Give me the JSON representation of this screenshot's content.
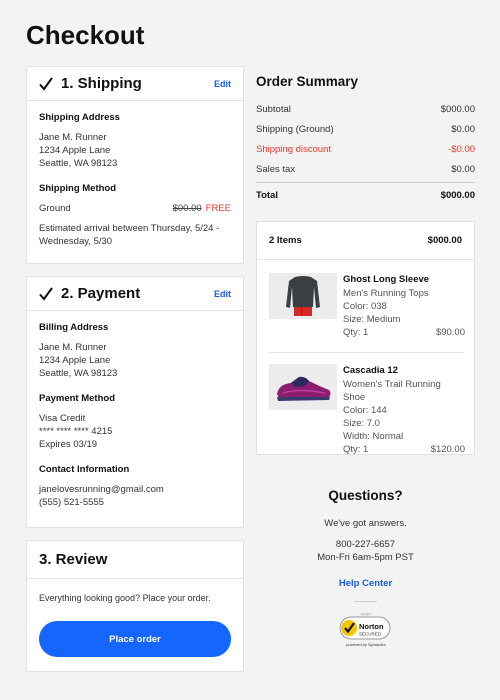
{
  "page": {
    "title": "Checkout"
  },
  "shipping": {
    "title": "1. Shipping",
    "edit_label": "Edit",
    "address_heading": "Shipping Address",
    "address": [
      "Jane M. Runner",
      "1234 Apple Lane",
      "Seattle, WA 98123"
    ],
    "method_heading": "Shipping Method",
    "method_name": "Ground",
    "method_original_price": "$00.00",
    "method_price": "FREE",
    "estimate": "Estimated arrival between Thursday, 5/24 - Wednesday, 5/30"
  },
  "payment": {
    "title": "2. Payment",
    "edit_label": "Edit",
    "billing_heading": "Billing Address",
    "billing": [
      "Jane M. Runner",
      "1234 Apple Lane",
      "Seattle, WA 98123"
    ],
    "method_heading": "Payment Method",
    "method": [
      "Visa Credit",
      "**** **** **** 4215",
      "Expires 03/19"
    ],
    "contact_heading": "Contact Information",
    "contact": [
      "janelovesrunning@gmail.com",
      "(555) 521-5555"
    ]
  },
  "review": {
    "title": "3. Review",
    "text": "Everything looking good? Place your order.",
    "button_label": "Place order"
  },
  "summary": {
    "title": "Order Summary",
    "rows": [
      {
        "label": "Subtotal",
        "value": "$000.00"
      },
      {
        "label": "Shipping (Ground)",
        "value": "$0.00"
      },
      {
        "label": "Shipping discount",
        "value": "-$0.00"
      },
      {
        "label": "Sales tax",
        "value": "$0.00"
      }
    ],
    "total": {
      "label": "Total",
      "value": "$000.00"
    }
  },
  "items": {
    "count_label": "2 Items",
    "total": "$000.00",
    "list": [
      {
        "name": "Ghost Long Sleeve",
        "category": "Men's Running Tops",
        "color": "Color: 038",
        "size": "Size: Medium",
        "qty": "Qty: 1",
        "price": "$90.00"
      },
      {
        "name": "Cascadia 12",
        "category": "Women's Trail Running Shoe",
        "color": "Color: 144",
        "size": "Size: 7.0",
        "width": "Width: Normal",
        "qty": "Qty: 1",
        "price": "$120.00"
      }
    ]
  },
  "questions": {
    "title": "Questions?",
    "subtitle": "We've got answers.",
    "phone": "800-227-6657",
    "hours": "Mon-Fri 6am-5pm PST",
    "help_label": "Help Center"
  },
  "badge": {
    "label": "Norton",
    "sub": "SECURED",
    "footer": "powered by Symantec",
    "top": "VERIFY"
  },
  "colors": {
    "accent": "#1566ff",
    "link": "#1a5ee0",
    "discount": "#e33b2e"
  },
  "icons": {
    "check": "check-icon"
  }
}
